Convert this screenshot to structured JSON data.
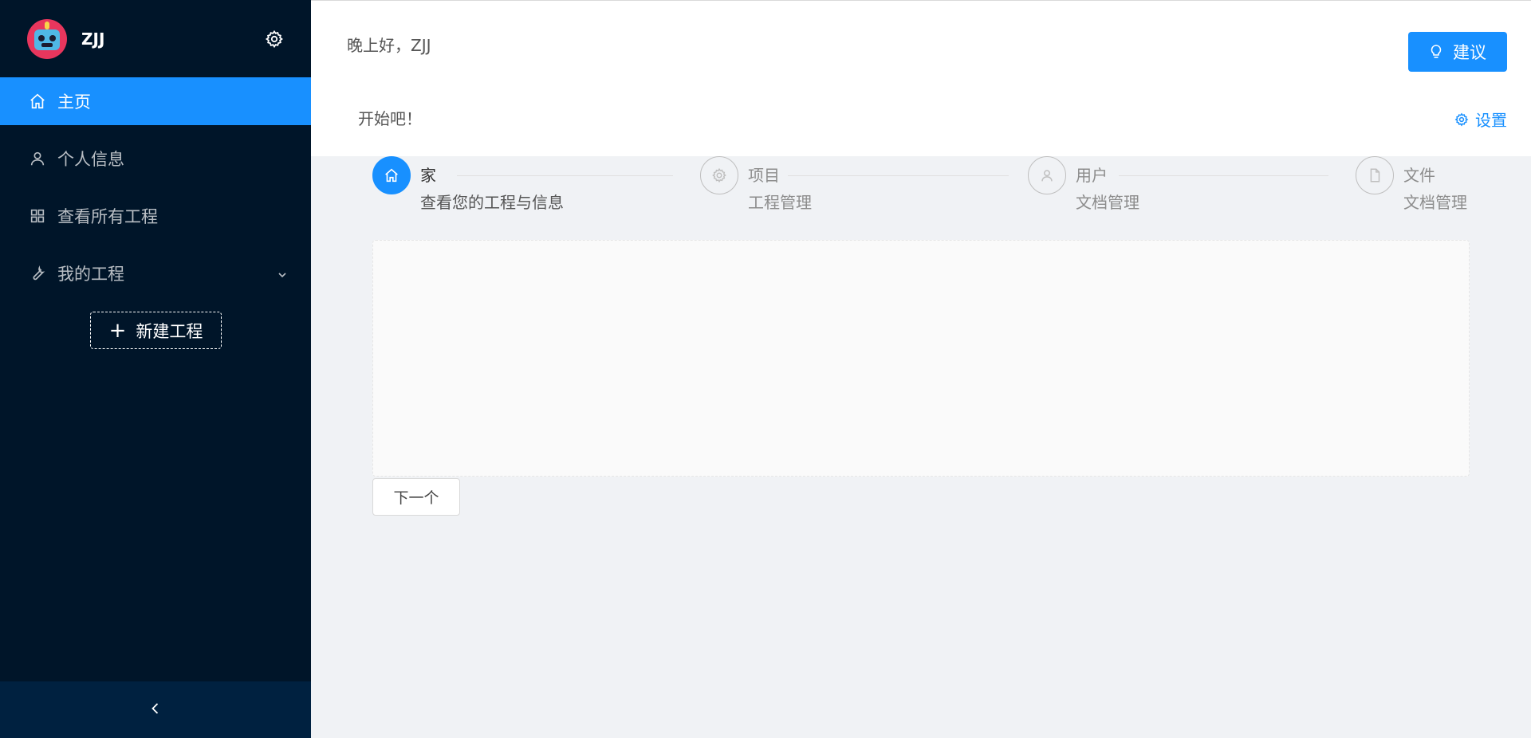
{
  "user": {
    "name": "ZJJ"
  },
  "sidebar": {
    "items": [
      {
        "label": "主页",
        "icon": "home-icon",
        "active": true
      },
      {
        "label": "个人信息",
        "icon": "user-icon",
        "active": false
      },
      {
        "label": "查看所有工程",
        "icon": "grid-icon",
        "active": false
      },
      {
        "label": "我的工程",
        "icon": "wrench-icon",
        "active": false,
        "expandable": true
      }
    ],
    "new_project_label": "新建工程",
    "collapse_icon": "chevron-left-icon"
  },
  "header": {
    "greeting": "晚上好，ZJJ",
    "suggest_label": "建议",
    "start_text": "开始吧！",
    "settings_label": "设置"
  },
  "steps": [
    {
      "title": "家",
      "desc": "查看您的工程与信息",
      "icon": "home-icon",
      "active": true
    },
    {
      "title": "项目",
      "desc": "工程管理",
      "icon": "gear-icon",
      "active": false
    },
    {
      "title": "用户",
      "desc": "文档管理",
      "icon": "user-icon",
      "active": false
    },
    {
      "title": "文件",
      "desc": "文档管理",
      "icon": "file-icon",
      "active": false
    }
  ],
  "next_label": "下一个",
  "colors": {
    "primary": "#1890ff",
    "sidebar_bg": "#001529",
    "collapse_bg": "#002140"
  }
}
